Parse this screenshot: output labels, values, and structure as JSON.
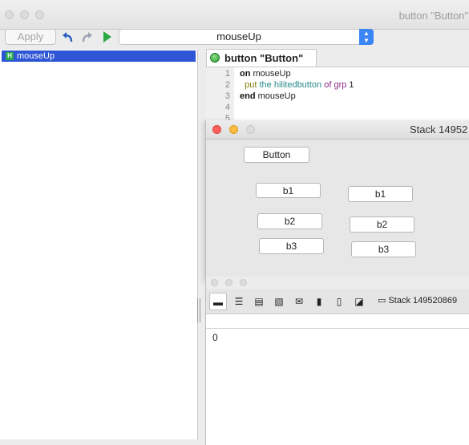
{
  "editor": {
    "title": "button \"Button\" o",
    "toolbar": {
      "apply_label": "Apply",
      "undo_icon": "undo-arrow-icon",
      "redo_icon": "redo-arrow-icon",
      "run_icon": "play-icon",
      "handler_select_value": "mouseUp"
    },
    "handlers": [
      {
        "badge": "H",
        "label": "mouseUp"
      }
    ],
    "tab": {
      "label": "button \"Button\""
    },
    "code": {
      "line_numbers": [
        "1",
        "2",
        "3",
        "4",
        "5"
      ],
      "lines": [
        {
          "kw": "on",
          "rest": " mouseUp"
        },
        {
          "indent": "  ",
          "cmd": "put",
          "mid": " the ",
          "prop": "hilitedbutton",
          "of": " of ",
          "obj": "grp",
          "num": " 1"
        },
        {
          "kw": "end",
          "rest": " mouseUp"
        }
      ]
    }
  },
  "stack": {
    "title": "Stack 14952",
    "buttons": {
      "main": "Button",
      "g1_b1": "b1",
      "g1_b2": "b2",
      "g1_b3": "b3",
      "g2_b1": "b1",
      "g2_b2": "b2",
      "g2_b3": "b3"
    }
  },
  "message_box": {
    "tools": [
      "single-line-icon",
      "multi-line-icon",
      "global-props-icon",
      "global-vars-icon",
      "pending-messages-icon",
      "front-scripts-icon",
      "back-scripts-icon",
      "library-icon"
    ],
    "stack_select": "Stack 149520869",
    "result": "0"
  },
  "colors": {
    "selection": "#2d55d6",
    "select_arrows": "#3b86f7",
    "run_green": "#2aa844",
    "close_red": "#fc605c",
    "minimize_yellow": "#fdbc40"
  }
}
